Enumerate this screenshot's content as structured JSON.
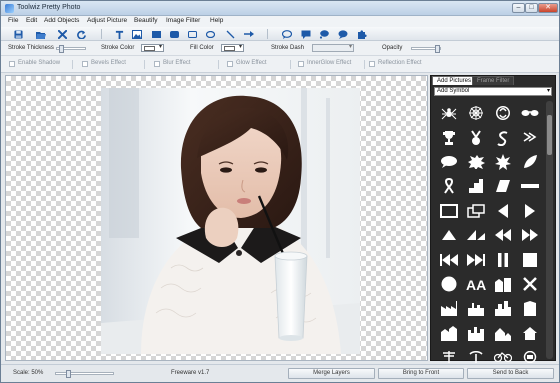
{
  "window": {
    "title": "Toolwiz Pretty Photo",
    "buttons": {
      "minimize": "–",
      "maximize": "□",
      "close": "✕"
    }
  },
  "menu": [
    "File",
    "Edit",
    "Add Objects",
    "Adjust Picture",
    "Beautify",
    "Image Filter",
    "Help"
  ],
  "toolbar": {
    "icons": [
      "save-icon",
      "open-icon",
      "delete-icon",
      "refresh-icon",
      "text-icon",
      "image-icon",
      "rectangle-icon",
      "rounded-rectangle-icon",
      "ellipse-icon",
      "line-icon",
      "arrow-icon",
      "speech-bubble-icon",
      "callout-icon",
      "thought-bubble-icon",
      "puzzle-icon"
    ]
  },
  "properties": {
    "stroke_thickness": "Stroke Thickness",
    "stroke_color": "Stroke Color",
    "fill_color": "Fill Color",
    "stroke_dash": "Stroke Dash",
    "opacity": "Opacity"
  },
  "effects": [
    "Enable Shadow",
    "Bevels Effect",
    "Blur Effect",
    "Glow Effect",
    "InnerGlow Effect",
    "Reflection Effect"
  ],
  "panel": {
    "tabs": [
      "Add Pictures",
      "Frame Filter"
    ],
    "active_tab": "Add Pictures",
    "category": "Add Symbol",
    "symbols": [
      "spider",
      "spiderweb",
      "biohazard",
      "glasses",
      "trophy",
      "medal",
      "swirl",
      "chevrons",
      "speech-oval",
      "explosion",
      "burst",
      "leaf",
      "ribbon",
      "steps",
      "parallelogram",
      "dash",
      "rectangle",
      "windows",
      "triangle-left",
      "triangle-right",
      "triangle-up",
      "triangles",
      "double-arrow-left",
      "double-arrow-right",
      "rewind",
      "fast-forward",
      "pause",
      "stop",
      "circle",
      "aa-letters",
      "city",
      "tools",
      "factory",
      "factory-2",
      "city-2",
      "building",
      "factory-3",
      "factory-4",
      "houses",
      "home",
      "power-line",
      "palm-tree",
      "bicycle",
      "mail"
    ]
  },
  "status": {
    "scale": "Scale: 50%",
    "version": "Freeware v1.7",
    "merge_layers": "Merge Layers",
    "bring_to_front": "Bring to Front",
    "send_to_back": "Send to Back",
    "zoom_fraction": 0.2
  }
}
